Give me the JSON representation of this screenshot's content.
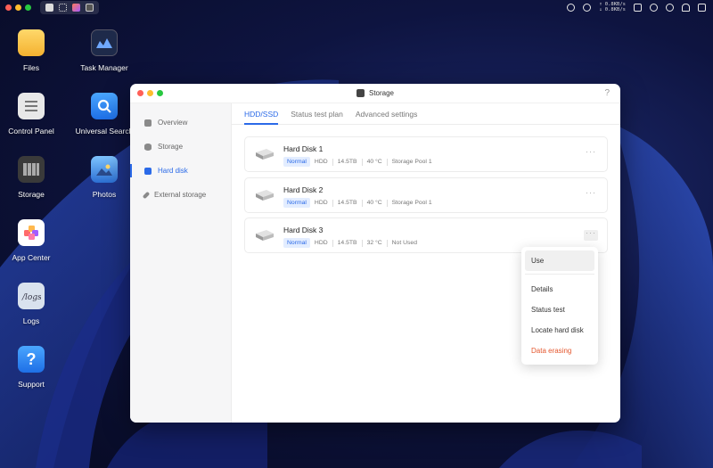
{
  "desktop": {
    "icons": [
      {
        "label": "Files"
      },
      {
        "label": "Task Manager"
      },
      {
        "label": "Control Panel"
      },
      {
        "label": "Universal Search"
      },
      {
        "label": "Storage"
      },
      {
        "label": "Photos"
      },
      {
        "label": "App Center"
      },
      {
        "label": "Logs"
      },
      {
        "label": "Support"
      }
    ]
  },
  "topbar": {
    "net_up": "↑ 0.8KB/s",
    "net_down": "↓ 0.8KB/s",
    "cpu_label": "CPU",
    "ram_label": "RAM"
  },
  "window": {
    "title": "Storage",
    "help": "?"
  },
  "sidebar": {
    "items": [
      {
        "label": "Overview"
      },
      {
        "label": "Storage"
      },
      {
        "label": "Hard disk"
      },
      {
        "label": "External storage"
      }
    ]
  },
  "tabs": [
    {
      "label": "HDD/SSD"
    },
    {
      "label": "Status test plan"
    },
    {
      "label": "Advanced settings"
    }
  ],
  "disks": [
    {
      "name": "Hard Disk 1",
      "status": "Normal",
      "type": "HDD",
      "size": "14.5TB",
      "temp": "40 °C",
      "pool": "Storage Pool 1"
    },
    {
      "name": "Hard Disk 2",
      "status": "Normal",
      "type": "HDD",
      "size": "14.5TB",
      "temp": "40 °C",
      "pool": "Storage Pool 1"
    },
    {
      "name": "Hard Disk 3",
      "status": "Normal",
      "type": "HDD",
      "size": "14.5TB",
      "temp": "32 °C",
      "pool": "Not Used"
    }
  ],
  "more_glyph": "···",
  "context_menu": {
    "items": [
      {
        "label": "Use"
      },
      {
        "label": "Details"
      },
      {
        "label": "Status test"
      },
      {
        "label": "Locate hard disk"
      },
      {
        "label": "Data erasing"
      }
    ]
  },
  "colors": {
    "accent": "#2b6ae8",
    "danger": "#e4572e",
    "close": "#ff5f57",
    "minimize": "#febc2e",
    "maximize": "#28c840"
  }
}
